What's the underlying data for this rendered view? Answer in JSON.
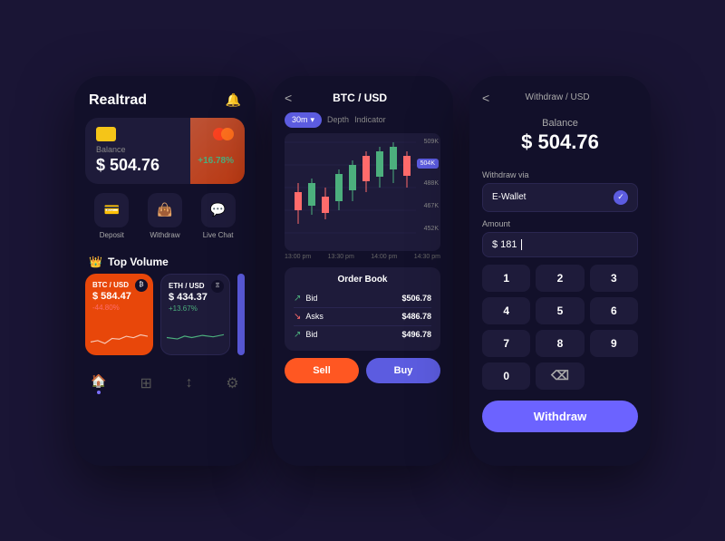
{
  "app": {
    "background": "#1a1535"
  },
  "phone1": {
    "title": "Realtrad",
    "bell_label": "🔔",
    "balance_label": "Balance",
    "balance_amount": "$ 504.76",
    "balance_change": "+16.78%",
    "actions": [
      {
        "label": "Deposit",
        "icon": "💳"
      },
      {
        "label": "Withdraw",
        "icon": "👜"
      },
      {
        "label": "Live Chat",
        "icon": "💬"
      }
    ],
    "section_title": "Top Volume",
    "crypto_cards": [
      {
        "pair": "BTC / USD",
        "price": "$ 584.47",
        "change": "-44.80%",
        "type": "btc"
      },
      {
        "pair": "ETH / USD",
        "price": "$ 434.37",
        "change": "+13.67%",
        "type": "eth"
      }
    ],
    "nav_items": [
      "🏠",
      "⊞",
      "↕",
      "⚙"
    ]
  },
  "phone2": {
    "back_label": "<",
    "title": "BTC / USD",
    "timeframe": "30m",
    "chart_labels": [
      "Depth",
      "Indicator"
    ],
    "price_levels": [
      "509K",
      "504K",
      "488K",
      "467K",
      "452K"
    ],
    "time_labels": [
      "13:00 pm",
      "13:30 pm",
      "14:00 pm",
      "14:30 pm"
    ],
    "orderbook_title": "Order Book",
    "orders": [
      {
        "type": "Bid",
        "price": "$506.78",
        "direction": "up"
      },
      {
        "type": "Asks",
        "price": "$486.78",
        "direction": "down"
      },
      {
        "type": "Bid",
        "price": "$496.78",
        "direction": "up"
      }
    ],
    "sell_label": "Sell",
    "buy_label": "Buy"
  },
  "phone3": {
    "back_label": "<",
    "header_title": "Withdraw / USD",
    "balance_label": "Balance",
    "balance_amount": "$ 504.76",
    "withdraw_via_label": "Withdraw via",
    "wallet_option": "E-Wallet",
    "amount_label": "Amount",
    "amount_value": "$ 181",
    "keypad": [
      "1",
      "2",
      "3",
      "4",
      "5",
      "6",
      "7",
      "8",
      "9",
      "0",
      "⌫"
    ],
    "withdraw_btn": "Withdraw"
  }
}
